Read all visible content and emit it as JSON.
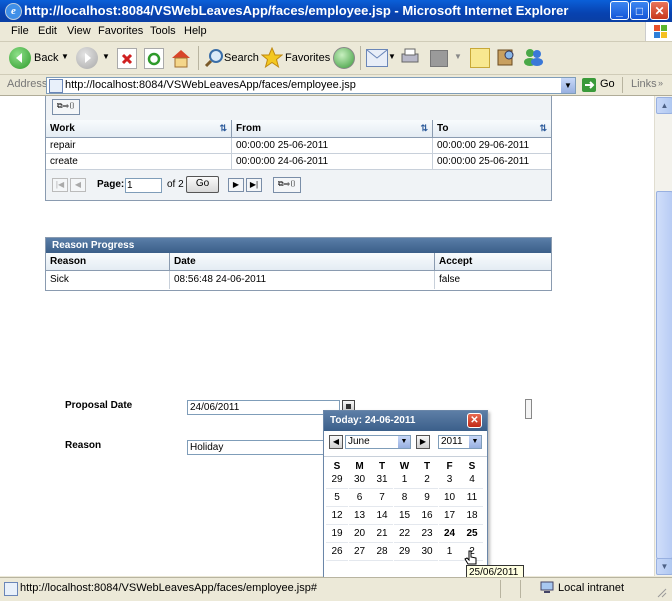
{
  "window": {
    "title": "http://localhost:8084/VSWebLeavesApp/faces/employee.jsp - Microsoft Internet Explorer"
  },
  "menu": [
    "File",
    "Edit",
    "View",
    "Favorites",
    "Tools",
    "Help"
  ],
  "toolbar": {
    "back": "Back",
    "search": "Search",
    "favorites": "Favorites"
  },
  "address": {
    "label": "Address",
    "url": "http://localhost:8084/VSWebLeavesApp/faces/employee.jsp",
    "go": "Go",
    "links": "Links"
  },
  "work_table": {
    "columns": [
      "Work",
      "From",
      "To"
    ],
    "rows": [
      [
        "repair",
        "00:00:00 25-06-2011",
        "00:00:00 29-06-2011"
      ],
      [
        "create",
        "00:00:00 24-06-2011",
        "00:00:00 25-06-2011"
      ]
    ],
    "pager": {
      "page_label": "Page:",
      "page_value": "1",
      "of_label": "of 2",
      "go": "Go"
    }
  },
  "reason_table": {
    "title": "Reason Progress",
    "columns": [
      "Reason",
      "Date",
      "Accept"
    ],
    "rows": [
      [
        "Sick",
        "08:56:48 24-06-2011",
        "false"
      ]
    ]
  },
  "form": {
    "proposal_label": "Proposal Date",
    "proposal_value": "24/06/2011",
    "reason_label": "Reason",
    "reason_value": "Holiday"
  },
  "calendar": {
    "title": "Today: 24-06-2011",
    "month": "June",
    "year": "2011",
    "weekdays": [
      "S",
      "M",
      "T",
      "W",
      "T",
      "F",
      "S"
    ],
    "weeks": [
      [
        "29",
        "30",
        "31",
        "1",
        "2",
        "3",
        "4"
      ],
      [
        "5",
        "6",
        "7",
        "8",
        "9",
        "10",
        "11"
      ],
      [
        "12",
        "13",
        "14",
        "15",
        "16",
        "17",
        "18"
      ],
      [
        "19",
        "20",
        "21",
        "22",
        "23",
        "24",
        "25"
      ],
      [
        "26",
        "27",
        "28",
        "29",
        "30",
        "1",
        "2"
      ]
    ],
    "tooltip": "25/06/2011"
  },
  "status": {
    "url": "http://localhost:8084/VSWebLeavesApp/faces/employee.jsp#",
    "zone": "Local intranet"
  }
}
